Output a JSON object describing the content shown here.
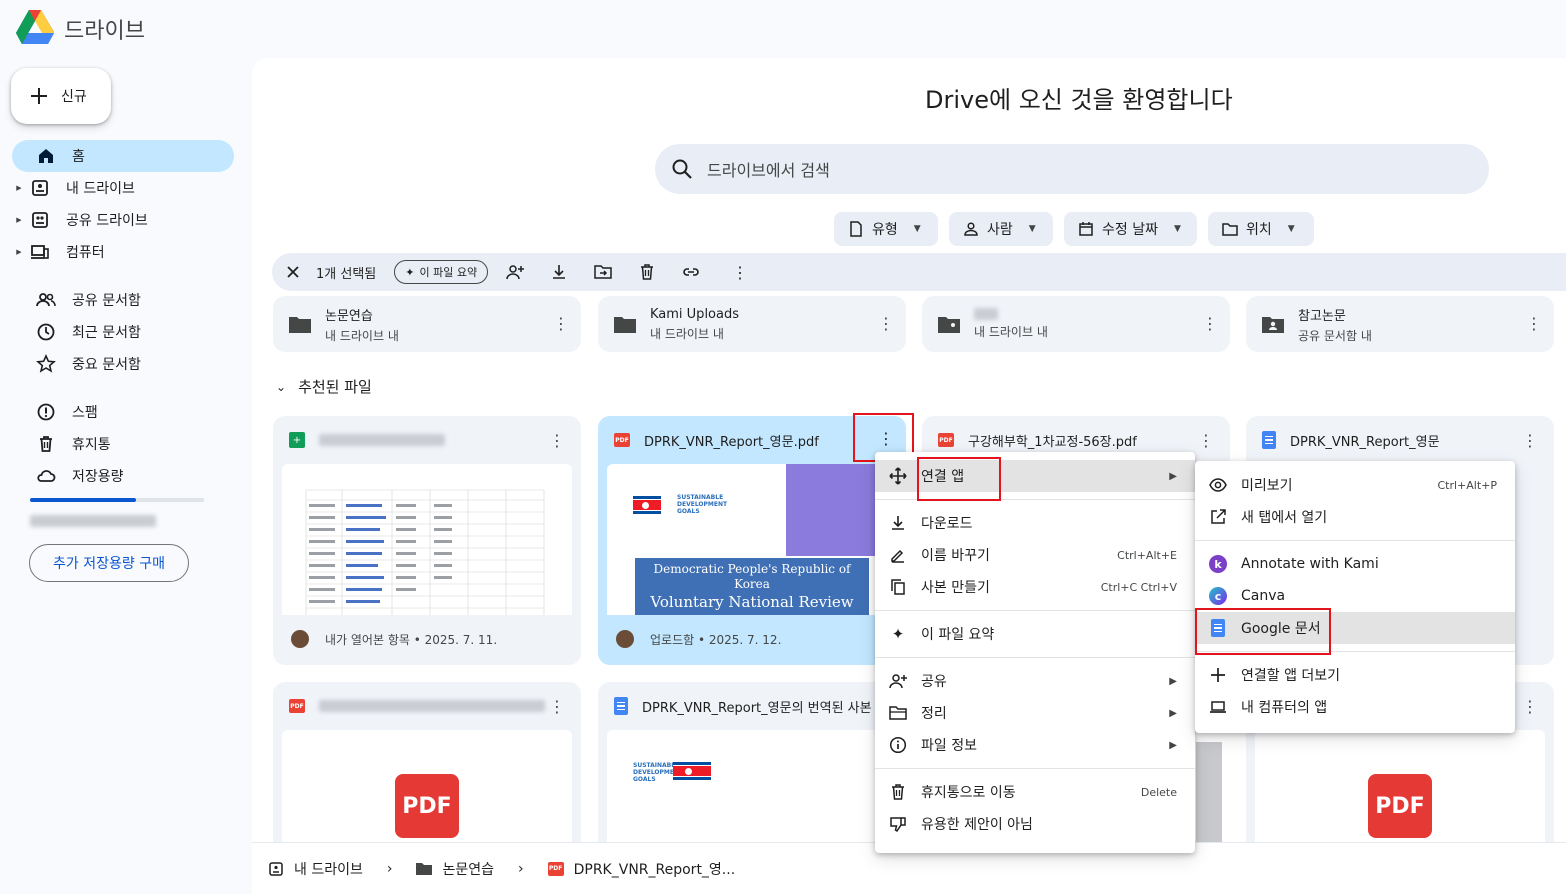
{
  "app": {
    "title": "드라이브"
  },
  "new_button": {
    "label": "신규"
  },
  "sidebar": {
    "items": [
      {
        "label": "홈",
        "icon": "home-icon"
      },
      {
        "label": "내 드라이브",
        "icon": "my-drive-icon"
      },
      {
        "label": "공유 드라이브",
        "icon": "shared-drives-icon"
      },
      {
        "label": "컴퓨터",
        "icon": "computers-icon"
      },
      {
        "label": "공유 문서함",
        "icon": "shared-with-me-icon"
      },
      {
        "label": "최근 문서함",
        "icon": "recent-icon"
      },
      {
        "label": "중요 문서함",
        "icon": "starred-icon"
      },
      {
        "label": "스팸",
        "icon": "spam-icon"
      },
      {
        "label": "휴지통",
        "icon": "trash-icon"
      },
      {
        "label": "저장용량",
        "icon": "storage-icon"
      }
    ],
    "storage_fraction": 0.61,
    "buy_storage": "추가 저장용량 구매"
  },
  "main": {
    "welcome": "Drive에 오신 것을 환영합니다",
    "search_placeholder": "드라이브에서 검색",
    "filters": [
      "유형",
      "사람",
      "수정 날짜",
      "위치"
    ],
    "selection": {
      "count_label": "1개 선택됨",
      "summarize_label": "이 파일 요약"
    },
    "folders": [
      {
        "name": "논문연습",
        "location": "내 드라이브 내"
      },
      {
        "name": "Kami Uploads",
        "location": "내 드라이브 내"
      },
      {
        "name": "",
        "location": "내 드라이브 내"
      },
      {
        "name": "참고논문",
        "location": "공유 문서함 내"
      }
    ],
    "recommended_title": "추천된 파일",
    "files": [
      {
        "name": "",
        "footer": "내가 열어본 항목 • 2025. 7. 11."
      },
      {
        "name": "DPRK_VNR_Report_영문.pdf",
        "footer": "업로드함 • 2025. 7. 12.",
        "thumb_line1": "Democratic People's Republic of",
        "thumb_line2": "Korea",
        "thumb_line3": "Voluntary National Review"
      },
      {
        "name": "구강해부학_1차교정-56장.pdf"
      },
      {
        "name": "DPRK_VNR_Report_영문"
      },
      {
        "name": ""
      },
      {
        "name": "DPRK_VNR_Report_영문의 번역된 사본"
      }
    ],
    "pdf_label": "PDF",
    "sdg_label": "SUSTAINABLE DEVELOPMENT GOALS"
  },
  "breadcrumb": [
    "내 드라이브",
    "논문연습",
    "DPRK_VNR_Report_영..."
  ],
  "context_menu": {
    "open_with": "연결 앱",
    "download": "다운로드",
    "rename": "이름 바꾸기",
    "rename_shortcut": "Ctrl+Alt+E",
    "copy": "사본 만들기",
    "copy_shortcut": "Ctrl+C Ctrl+V",
    "summarize": "이 파일 요약",
    "share": "공유",
    "organize": "정리",
    "file_info": "파일 정보",
    "trash": "휴지통으로 이동",
    "trash_shortcut": "Delete",
    "not_helpful": "유용한 제안이 아님"
  },
  "open_with_menu": {
    "preview": "미리보기",
    "preview_shortcut": "Ctrl+Alt+P",
    "new_tab": "새 탭에서 열기",
    "kami": "Annotate with Kami",
    "canva": "Canva",
    "docs": "Google 문서",
    "more_apps": "연결할 앱 더보기",
    "computer_apps": "내 컴퓨터의 앱"
  },
  "colors": {
    "accent": "#0b57d0",
    "selected": "#c2e7ff",
    "highlight_box": "#e3141b"
  }
}
